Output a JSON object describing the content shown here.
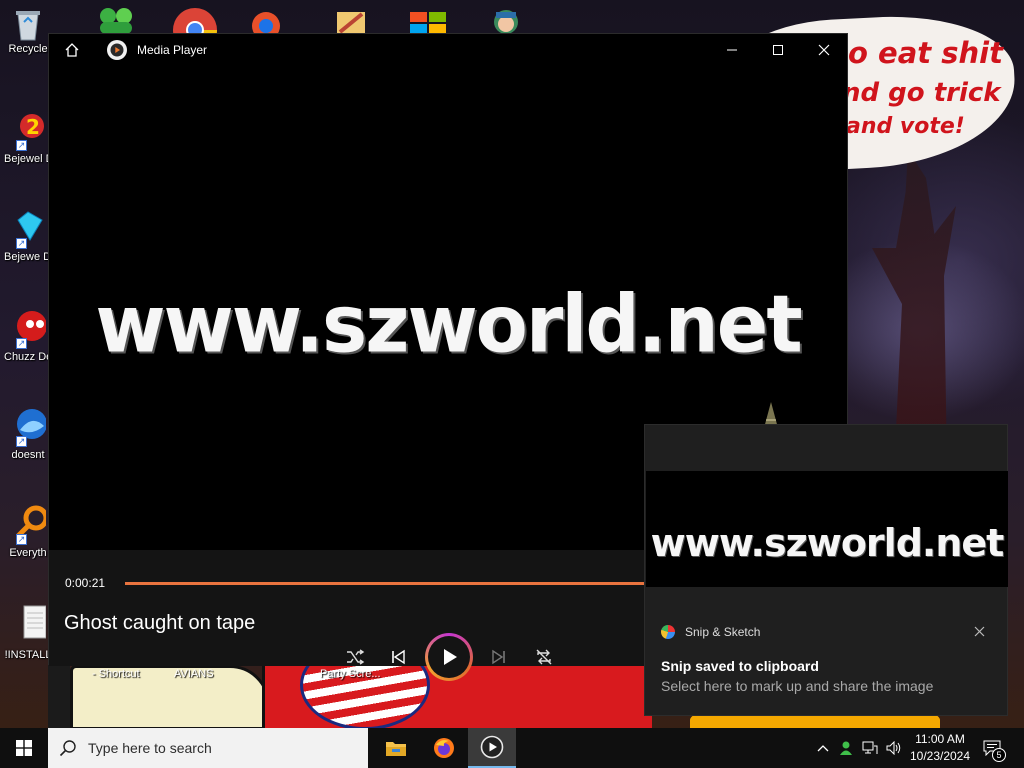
{
  "desktop": {
    "wallpaper_text": [
      "o eat shit",
      "nd go trick",
      "and vote!"
    ],
    "icons": [
      {
        "label": "Recycle"
      },
      {
        "label": "Bejewel Delux"
      },
      {
        "label": "Bejewe Delux"
      },
      {
        "label": "Chuzz Delux"
      },
      {
        "label": "doesnt"
      },
      {
        "label": "Everyth"
      },
      {
        "label": "!INSTALL"
      }
    ],
    "bottom_labels": [
      "- Shortcut",
      "AVIANS",
      "Party Scre..."
    ]
  },
  "media_player": {
    "title": "Media Player",
    "video_text": "www.szworld.net",
    "current_time": "0:00:21",
    "progress_fraction": 0.82,
    "track_title": "Ghost caught on tape",
    "accent_color": "#e9743f",
    "controls": [
      "shuffle-icon",
      "previous-icon",
      "play-icon",
      "next-icon",
      "repeat-icon"
    ]
  },
  "toast": {
    "thumbnail_text": "www.szworld.net",
    "app_name": "Snip & Sketch",
    "heading": "Snip saved to clipboard",
    "body": "Select here to mark up and share the image"
  },
  "taskbar": {
    "search_placeholder": "Type here to search",
    "time": "11:00 AM",
    "date": "10/23/2024",
    "notification_count": "5"
  }
}
